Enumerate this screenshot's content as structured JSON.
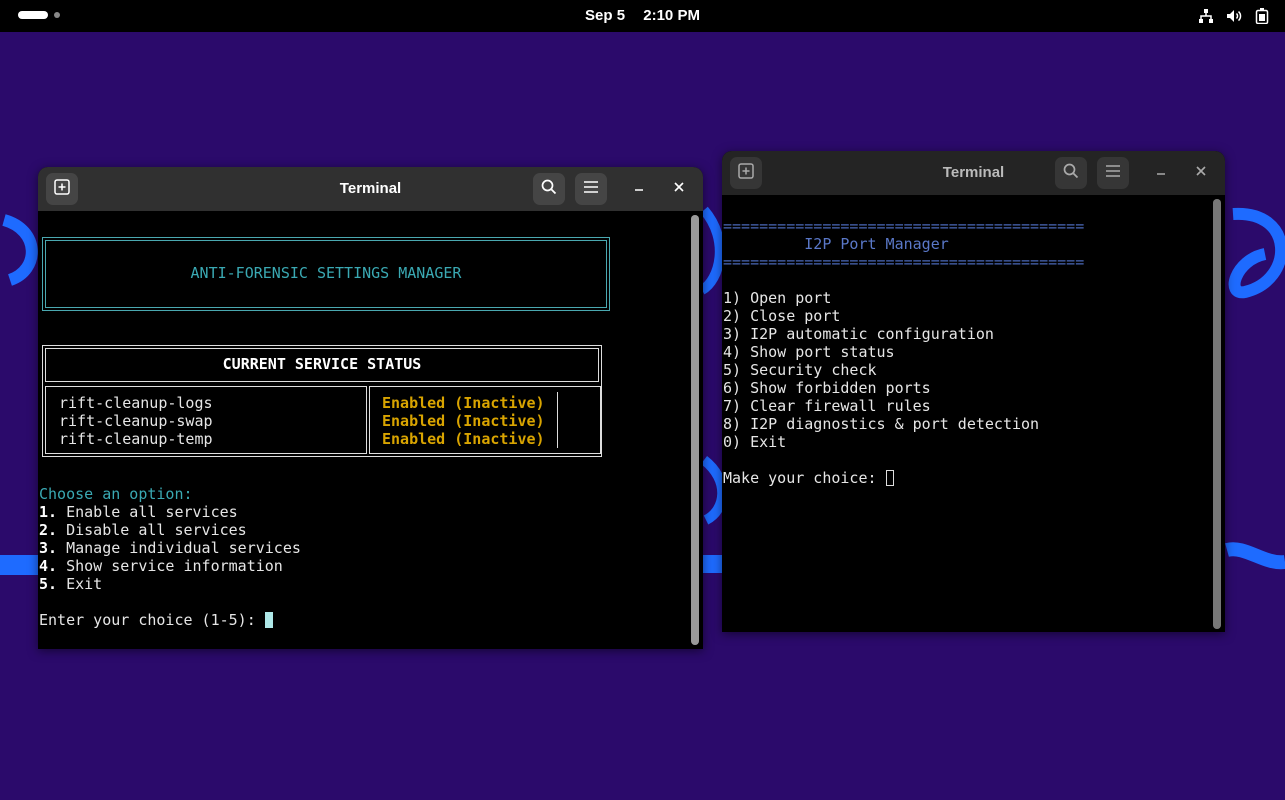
{
  "topbar": {
    "date": "Sep 5",
    "time": "2:10 PM",
    "icons": [
      "network-icon",
      "volume-icon",
      "battery-icon"
    ]
  },
  "colors": {
    "wallpaper": "#2b0a6b",
    "accent_blue": "#1e6bff",
    "teal": "#3aa9b3",
    "status_yellow": "#d9a400"
  },
  "window_left": {
    "title": "Terminal",
    "banner": "ANTI-FORENSIC SETTINGS MANAGER",
    "status_header": "CURRENT SERVICE STATUS",
    "services": [
      {
        "name": "rift-cleanup-logs",
        "status": "Enabled (Inactive)"
      },
      {
        "name": "rift-cleanup-swap",
        "status": "Enabled (Inactive)"
      },
      {
        "name": "rift-cleanup-temp",
        "status": "Enabled (Inactive)"
      }
    ],
    "menu_heading": "Choose an option:",
    "menu": [
      {
        "num": "1.",
        "label": " Enable all services"
      },
      {
        "num": "2.",
        "label": " Disable all services"
      },
      {
        "num": "3.",
        "label": " Manage individual services"
      },
      {
        "num": "4.",
        "label": " Show service information"
      },
      {
        "num": "5.",
        "label": " Exit"
      }
    ],
    "prompt": "Enter your choice (1-5): "
  },
  "window_right": {
    "title": "Terminal",
    "separator": "========================================",
    "heading": "         I2P Port Manager",
    "menu": [
      "1) Open port",
      "2) Close port",
      "3) I2P automatic configuration",
      "4) Show port status",
      "5) Security check",
      "6) Show forbidden ports",
      "7) Clear firewall rules",
      "8) I2P diagnostics & port detection",
      "0) Exit"
    ],
    "prompt": "Make your choice: "
  }
}
